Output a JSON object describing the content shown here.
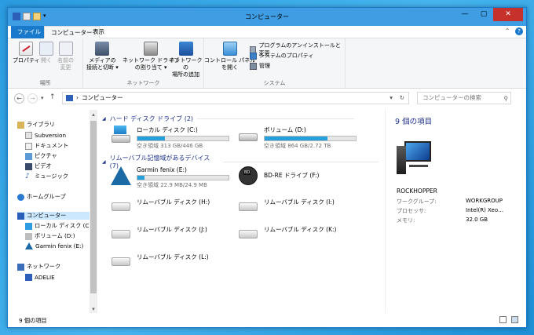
{
  "window": {
    "title": "コンピューター",
    "minimize": "—",
    "maximize": "▢",
    "close": "✕"
  },
  "tabs": {
    "file": "ファイル",
    "computer": "コンピューター",
    "view": "表示",
    "collapse": "⌃",
    "help": "?"
  },
  "ribbon": {
    "location": {
      "label": "場所",
      "properties": "プロパティ",
      "open": "開く",
      "rename_line1": "名前の",
      "rename_line2": "変更"
    },
    "network": {
      "label": "ネットワーク",
      "media_line1": "メディアの",
      "media_line2": "接続と切断 ▾",
      "map_line1": "ネットワーク ドライブ",
      "map_line2": "の割り当て ▾",
      "add_line1": "ネットワークの",
      "add_line2": "場所の追加"
    },
    "system": {
      "label": "システム",
      "control_line1": "コントロール パネル",
      "control_line2": "を開く",
      "uninstall": "プログラムのアンインストールと変更",
      "sysprops": "システムのプロパティ",
      "manage": "管理"
    }
  },
  "navbar": {
    "back": "←",
    "forward": "→",
    "recent": "▾",
    "up": "↑",
    "address": "コンピューター",
    "address_sep": "›",
    "address_dropdown": "▾",
    "refresh": "↻",
    "search_placeholder": "コンピューターの検索",
    "search_icon": "⚲"
  },
  "nav": {
    "libraries": "ライブラリ",
    "subversion": "Subversion",
    "documents": "ドキュメント",
    "pictures": "ピクチャ",
    "videos": "ビデオ",
    "music": "ミュージック",
    "homegroup": "ホームグループ",
    "computer": "コンピューター",
    "local_c": "ローカル ディスク (C:)",
    "volume_d": "ボリューム (D:)",
    "garmin_e": "Garmin fenix (E:)",
    "network": "ネットワーク",
    "adelie": "ADELIE"
  },
  "content": {
    "hdd_header": "ハード ディスク ドライブ (2)",
    "removable_header": "リムーバブル記憶域があるデバイス (7)",
    "drive_c": {
      "name": "ローカル ディスク (C:)",
      "free": "空き領域 313 GB/446 GB",
      "used_pct": 30
    },
    "drive_d": {
      "name": "ボリューム (D:)",
      "free": "空き領域 864 GB/2.72 TB",
      "used_pct": 69
    },
    "drive_e": {
      "name": "Garmin fenix (E:)",
      "free": "空き領域 22.9 MB/24.9 MB",
      "used_pct": 8
    },
    "drive_f": {
      "name": "BD-RE ドライブ (F:)"
    },
    "drive_h": "リムーバブル ディスク (H:)",
    "drive_i": "リムーバブル ディスク (I:)",
    "drive_j": "リムーバブル ディスク (J:)",
    "drive_k": "リムーバブル ディスク (K:)",
    "drive_l": "リムーバブル ディスク (L:)"
  },
  "details": {
    "count": "9 個の項目",
    "computer_name": "ROCKHOPPER",
    "workgroup_label": "ワークグループ:",
    "workgroup_value": "WORKGROUP",
    "processor_label": "プロセッサ:",
    "processor_value": "Intel(R) Xeo…",
    "memory_label": "メモリ:",
    "memory_value": "32.0 GB"
  },
  "status": {
    "count": "9 個の項目"
  },
  "colors": {
    "accent": "#1979ca",
    "titlebar": "#3f9de3",
    "drive_bar": "#26a0da",
    "group_header": "#1e3287",
    "close": "#c7312b"
  }
}
